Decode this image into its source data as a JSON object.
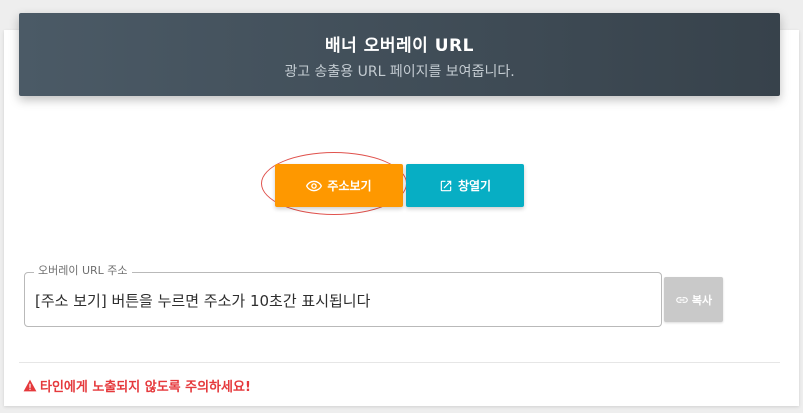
{
  "header": {
    "title": "배너 오버레이 URL",
    "subtitle": "광고 송출용 URL 페이지를 보여줍니다."
  },
  "buttons": {
    "view_label": "주소보기",
    "view_icon": "eye-icon",
    "open_label": "창열기",
    "open_icon": "external-link-icon",
    "view_color": "#fe9800",
    "open_color": "#07aec4"
  },
  "url_field": {
    "label": "오버레이 URL 주소",
    "value": "[주소 보기] 버튼을 누르면 주소가 10초간 표시됩니다"
  },
  "copy_button": {
    "label": "복사",
    "icon": "link-icon"
  },
  "warning": {
    "text": "타인에게 노출되지 않도록 주의하세요!",
    "icon": "warning-triangle-icon",
    "color": "#e5393c"
  }
}
